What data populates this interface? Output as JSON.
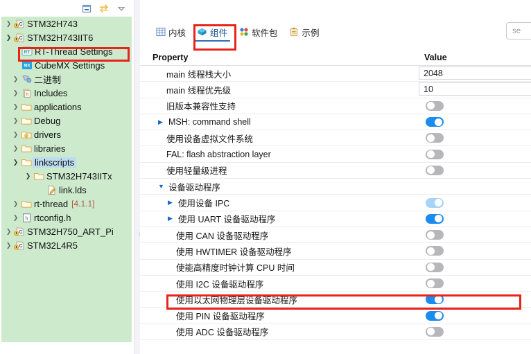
{
  "explorer": {
    "toolbar": [
      {
        "name": "collapse-all-icon",
        "title": "Collapse All"
      },
      {
        "name": "link-with-editor-icon",
        "title": "Link with Editor"
      },
      {
        "name": "view-menu-icon",
        "title": "View Menu"
      }
    ],
    "tree": [
      {
        "label": "STM32H743",
        "icon": "c-project-icon",
        "arrow": "collapsed",
        "indent": 0,
        "version": ""
      },
      {
        "label": "STM32H743IIT6",
        "icon": "c-project-icon",
        "arrow": "expanded",
        "indent": 0,
        "version": ""
      },
      {
        "label": "RT-Thread Settings",
        "icon": "rt-thread-icon",
        "arrow": "none",
        "indent": 1,
        "version": ""
      },
      {
        "label": "CubeMX Settings",
        "icon": "cubemx-icon",
        "arrow": "none",
        "indent": 1,
        "version": ""
      },
      {
        "label": "二进制",
        "icon": "binaries-icon",
        "arrow": "collapsed",
        "indent": 1,
        "version": ""
      },
      {
        "label": "Includes",
        "icon": "includes-icon",
        "arrow": "collapsed",
        "indent": 1,
        "version": ""
      },
      {
        "label": "applications",
        "icon": "folder-icon",
        "arrow": "collapsed",
        "indent": 1,
        "version": ""
      },
      {
        "label": "Debug",
        "icon": "folder-icon",
        "arrow": "collapsed",
        "indent": 1,
        "version": ""
      },
      {
        "label": "drivers",
        "icon": "folder-icon",
        "arrow": "collapsed",
        "indent": 1,
        "version": ""
      },
      {
        "label": "libraries",
        "icon": "folder-icon",
        "arrow": "collapsed",
        "indent": 1,
        "version": ""
      },
      {
        "label": "linkscripts",
        "icon": "folder-icon",
        "arrow": "expanded",
        "indent": 1,
        "version": "",
        "selected": true
      },
      {
        "label": "STM32H743IITx",
        "icon": "folder-icon",
        "arrow": "expanded",
        "indent": 2,
        "version": ""
      },
      {
        "label": "link.lds",
        "icon": "lds-file-icon",
        "arrow": "none",
        "indent": 3,
        "version": ""
      },
      {
        "label": "rt-thread",
        "icon": "folder-icon",
        "arrow": "collapsed",
        "indent": 1,
        "version": "[4.1.1]"
      },
      {
        "label": "rtconfig.h",
        "icon": "header-file-icon",
        "arrow": "collapsed",
        "indent": 1,
        "version": ""
      },
      {
        "label": "STM32H750_ART_Pi",
        "icon": "c-project-icon",
        "arrow": "collapsed",
        "indent": 0,
        "version": ""
      },
      {
        "label": "STM32L4R5",
        "icon": "c-project-icon",
        "arrow": "collapsed",
        "indent": 0,
        "version": ""
      }
    ]
  },
  "sash": {
    "handle_label": "»"
  },
  "editor": {
    "tabs": [
      {
        "label": "内核",
        "icon": "kernel-grid-icon",
        "active": false
      },
      {
        "label": "组件",
        "icon": "components-cube-icon",
        "active": true
      },
      {
        "label": "软件包",
        "icon": "packages-dots-icon",
        "active": false
      },
      {
        "label": "示例",
        "icon": "examples-clipboard-icon",
        "active": false
      }
    ],
    "search": {
      "value": "se",
      "placeholder": "search"
    },
    "table": {
      "headers": {
        "property": "Property",
        "value": "Value"
      },
      "rows": [
        {
          "label": "main 线程栈大小",
          "indent": 1,
          "twisty": "none",
          "control": "input",
          "value": "2048"
        },
        {
          "label": "main 线程优先级",
          "indent": 1,
          "twisty": "none",
          "control": "input",
          "value": "10"
        },
        {
          "label": "旧版本兼容性支持",
          "indent": 1,
          "twisty": "none",
          "control": "toggle",
          "state": "off"
        },
        {
          "label": "MSH: command shell",
          "indent": 1,
          "twisty": "collapsed",
          "control": "toggle",
          "state": "on"
        },
        {
          "label": "使用设备虚拟文件系统",
          "indent": 1,
          "twisty": "none",
          "control": "toggle",
          "state": "off"
        },
        {
          "label": "FAL: flash abstraction layer",
          "indent": 1,
          "twisty": "none",
          "control": "toggle",
          "state": "off"
        },
        {
          "label": "使用轻量级进程",
          "indent": 1,
          "twisty": "none",
          "control": "toggle",
          "state": "off"
        },
        {
          "label": "设备驱动程序",
          "indent": 1,
          "twisty": "expanded",
          "control": "none"
        },
        {
          "label": "使用设备 IPC",
          "indent": 2,
          "twisty": "collapsed",
          "control": "toggle",
          "state": "on-dim"
        },
        {
          "label": "使用 UART 设备驱动程序",
          "indent": 2,
          "twisty": "collapsed",
          "control": "toggle",
          "state": "on"
        },
        {
          "label": "使用 CAN 设备驱动程序",
          "indent": 2,
          "twisty": "none",
          "control": "toggle",
          "state": "off"
        },
        {
          "label": "使用 HWTIMER 设备驱动程序",
          "indent": 2,
          "twisty": "none",
          "control": "toggle",
          "state": "off"
        },
        {
          "label": "使能高精度时钟计算 CPU 时间",
          "indent": 2,
          "twisty": "none",
          "control": "toggle",
          "state": "off"
        },
        {
          "label": "使用 I2C 设备驱动程序",
          "indent": 2,
          "twisty": "none",
          "control": "toggle",
          "state": "off"
        },
        {
          "label": "使用以太网物理层设备驱动程序",
          "indent": 2,
          "twisty": "none",
          "control": "toggle",
          "state": "on",
          "highlighted": true
        },
        {
          "label": "使用 PIN 设备驱动程序",
          "indent": 2,
          "twisty": "none",
          "control": "toggle",
          "state": "on"
        },
        {
          "label": "使用 ADC 设备驱动程序",
          "indent": 2,
          "twisty": "none",
          "control": "toggle",
          "state": "off"
        }
      ]
    }
  },
  "annotations": {
    "color": "#e8231a",
    "boxes": [
      {
        "name": "rt-thread-settings-highlight",
        "target": "RT-Thread Settings"
      },
      {
        "name": "components-tab-highlight",
        "target": "组件"
      },
      {
        "name": "eth-phy-driver-row-highlight",
        "target": "使用以太网物理层设备驱动程序"
      }
    ]
  }
}
